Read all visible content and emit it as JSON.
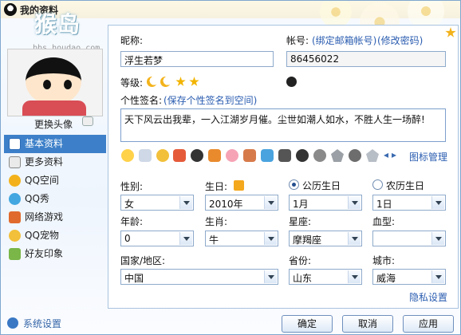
{
  "window": {
    "title": "我的资料"
  },
  "logo": {
    "text": "猴岛",
    "url": "bbs.houdao.com"
  },
  "avatar": {
    "change_label": "更换头像"
  },
  "sidebar": {
    "items": [
      {
        "label": "基本资料",
        "icon": "profile-card-icon",
        "active": true
      },
      {
        "label": "更多资料",
        "icon": "more-info-icon",
        "active": false
      },
      {
        "label": "QQ空间",
        "icon": "qzone-icon",
        "active": false
      },
      {
        "label": "QQ秀",
        "icon": "qq-show-icon",
        "active": false
      },
      {
        "label": "网络游戏",
        "icon": "game-icon",
        "active": false
      },
      {
        "label": "QQ宠物",
        "icon": "pet-icon",
        "active": false
      },
      {
        "label": "好友印象",
        "icon": "impression-icon",
        "active": false
      }
    ],
    "system_settings": "系统设置"
  },
  "form": {
    "nickname_label": "昵称:",
    "nickname_value": "浮生若梦",
    "account_label": "帐号:",
    "bind_email_link": "(绑定邮箱帐号)",
    "change_password_link": "(修改密码)",
    "account_value": "86456022",
    "level_label": "等级:",
    "signature_label": "个性签名:",
    "save_signature_link": "(保存个性签名到空间)",
    "signature_value": "天下风云出我辈，一入江湖岁月催。尘世如潮人如水，不胜人生一场醉!",
    "icon_manage_link": "图标管理",
    "gender_label": "性别:",
    "gender_value": "女",
    "birthday_label": "生日:",
    "solar_label": "公历生日",
    "lunar_label": "农历生日",
    "year_value": "2010年",
    "month_value": "1月",
    "day_value": "1日",
    "age_label": "年龄:",
    "age_value": "0",
    "zodiac_label": "生肖:",
    "zodiac_value": "牛",
    "constellation_label": "星座:",
    "constellation_value": "摩羯座",
    "blood_label": "血型:",
    "blood_value": "",
    "country_label": "国家/地区:",
    "country_value": "中国",
    "province_label": "省份:",
    "province_value": "山东",
    "city_label": "城市:",
    "city_value": "威海",
    "privacy_link": "隐私设置"
  },
  "buttons": {
    "ok": "确定",
    "cancel": "取消",
    "apply": "应用"
  },
  "colors": {
    "accent": "#3d80c9",
    "link": "#2b5db0",
    "border": "#8eaacb"
  }
}
